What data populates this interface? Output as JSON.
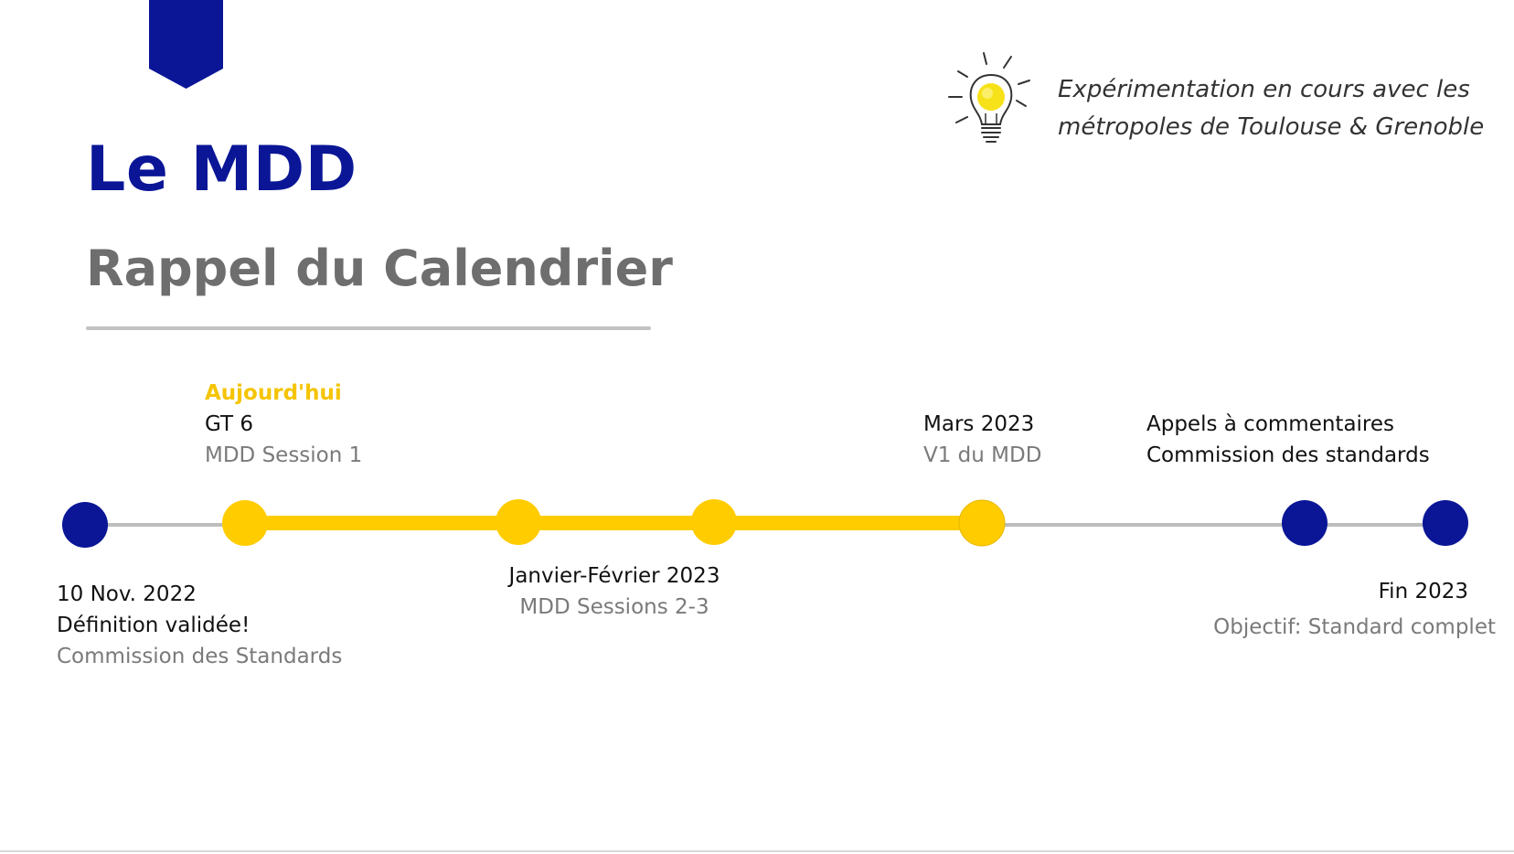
{
  "header": {
    "title": "Le MDD",
    "subtitle": "Rappel du Calendrier"
  },
  "note": {
    "icon": "lightbulb-icon",
    "line1": "Expérimentation en cours avec les",
    "line2": "métropoles de Toulouse & Grenoble"
  },
  "colors": {
    "brand_blue": "#0a1696",
    "accent_yellow": "#ffcc00",
    "line_gray": "#bdbdbd"
  },
  "timeline": {
    "nov2022": {
      "date": "10 Nov. 2022",
      "line2": "Définition validée!",
      "line3": "Commission des Standards"
    },
    "today": {
      "tag": "Aujourd'hui",
      "line1": "GT 6",
      "line2": "MDD Session 1"
    },
    "janfeb": {
      "line1": "Janvier-Février 2023",
      "line2": "MDD Sessions 2-3"
    },
    "mars": {
      "line1": "Mars 2023",
      "line2": "V1 du MDD"
    },
    "appels": {
      "line1": "Appels à commentaires",
      "line2": "Commission des standards"
    },
    "fin": {
      "line1": "Fin 2023",
      "line2": "Objectif: Standard complet"
    }
  }
}
